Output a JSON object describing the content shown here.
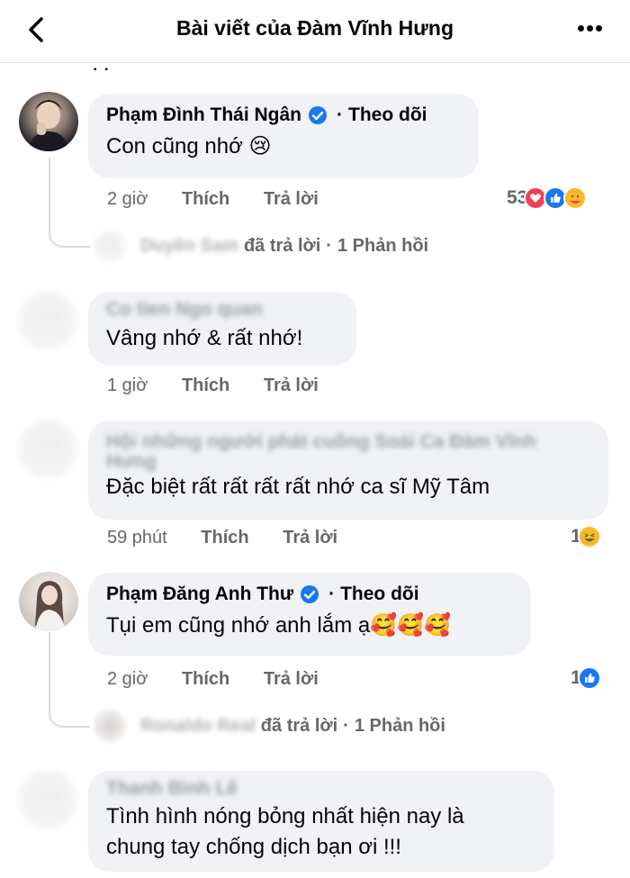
{
  "header": {
    "title": "Bài viết của Đàm Vĩnh Hưng"
  },
  "comments": [
    {
      "name": "Phạm Đình Thái Ngân",
      "verified": true,
      "follow": "Theo dõi",
      "text": "Con cũng nhớ",
      "emoji": "😢",
      "time": "2 giờ",
      "like": "Thích",
      "reply": "Trả lời",
      "reaction_count": "53",
      "reactions": [
        "love-icon",
        "like-icon",
        "care-icon"
      ],
      "replies": {
        "name": "Duyên Sam",
        "action": "đã trả lời",
        "sep": "·",
        "count_label": "1 Phản hồi"
      }
    },
    {
      "name": "Co tien Ngo quan",
      "text": "Vâng nhớ & rất nhớ!",
      "time": "1 giờ",
      "like": "Thích",
      "reply": "Trả lời"
    },
    {
      "name_line1": "Hội những người phát cuồng Soái Ca Đàm Vĩnh",
      "name_line2": "Hưng",
      "text": "Đặc biệt rất rất rất rất nhớ ca sĩ Mỹ Tâm",
      "time": "59 phút",
      "like": "Thích",
      "reply": "Trả lời",
      "reaction_count": "1",
      "reactions": [
        "haha-icon"
      ]
    },
    {
      "name": "Phạm Đăng Anh Thư",
      "verified": true,
      "follow": "Theo dõi",
      "text": "Tụi em cũng nhớ anh lắm ạ",
      "emoji": "🥰🥰🥰",
      "time": "2 giờ",
      "like": "Thích",
      "reply": "Trả lời",
      "reaction_count": "1",
      "reactions": [
        "like-icon"
      ],
      "replies": {
        "name": "Ronaldo Real",
        "action": "đã trả lời",
        "sep": "·",
        "count_label": "1 Phản hồi"
      }
    },
    {
      "name": "Thanh Bình Lê",
      "text_line1": "Tình hình nóng bỏng nhất hiện nay là",
      "text_line2": "chung tay chống dịch bạn ơi !!!"
    }
  ],
  "colors": {
    "bubble": "#f0f2f5",
    "meta": "#65676b",
    "verified": "#1877f2",
    "like": "#1877f2",
    "love": "#f33e58"
  }
}
